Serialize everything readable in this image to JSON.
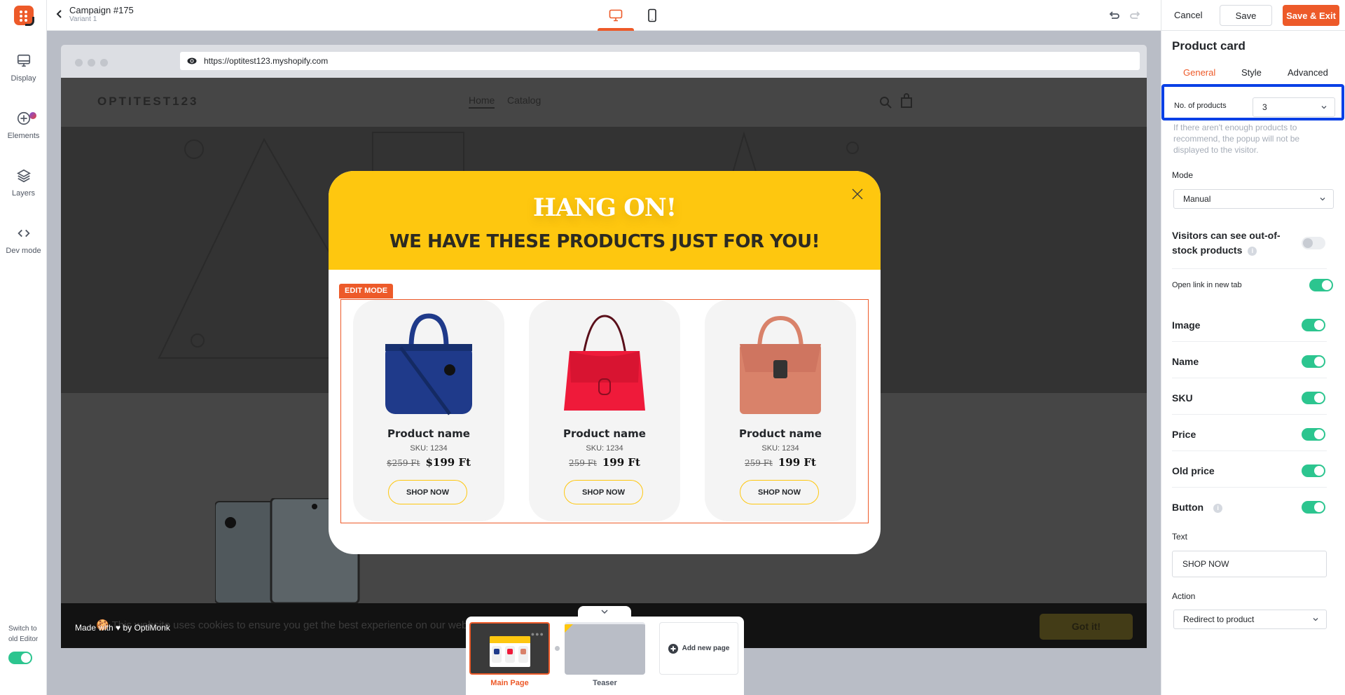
{
  "app": {
    "campaign_title": "Campaign #175",
    "variant": "Variant 1",
    "icons": {
      "logo": "optimonk-logo",
      "back": "chevron-left-icon",
      "desktop": "desktop-icon",
      "mobile": "mobile-icon",
      "undo": "undo-icon",
      "redo": "redo-icon"
    },
    "active_device": "desktop"
  },
  "actions": {
    "cancel": "Cancel",
    "save": "Save",
    "save_exit": "Save & Exit"
  },
  "sidebar": {
    "items": [
      {
        "label": "Display",
        "icon": "monitor-icon"
      },
      {
        "label": "Elements",
        "icon": "plus-circle-icon",
        "has_notification": true
      },
      {
        "label": "Layers",
        "icon": "layers-icon"
      },
      {
        "label": "Dev mode",
        "icon": "code-icon"
      }
    ],
    "switch_old_editor": "Switch to old Editor",
    "switch_old_editor_on": true
  },
  "browser": {
    "url": "https://optitest123.myshopify.com"
  },
  "store": {
    "logo": "OPTITEST123",
    "nav": [
      "Home",
      "Catalog"
    ],
    "cookie_text": "This website uses cookies to ensure you get the best experience on our website",
    "cookie_button": "Got it!",
    "made_with": "Made with ♥ by OptiMonk"
  },
  "popup": {
    "headline": "HANG ON!",
    "subheadline": "WE HAVE THESE PRODUCTS JUST FOR YOU!",
    "edit_badge": "EDIT MODE",
    "products": [
      {
        "name": "Product name",
        "sku": "SKU: 1234",
        "old_price": "$259 Ft",
        "price": "$199 Ft",
        "button": "SHOP NOW",
        "color": "#1f3a8a"
      },
      {
        "name": "Product name",
        "sku": "SKU: 1234",
        "old_price": "259 Ft",
        "price": "199 Ft",
        "button": "SHOP NOW",
        "color": "#ef1a3a"
      },
      {
        "name": "Product name",
        "sku": "SKU: 1234",
        "old_price": "259 Ft",
        "price": "199 Ft",
        "button": "SHOP NOW",
        "color": "#d9826a"
      }
    ]
  },
  "pages": {
    "items": [
      {
        "label": "Main Page",
        "active": true
      },
      {
        "label": "Teaser",
        "active": false
      }
    ],
    "add_label": "Add new page"
  },
  "panel": {
    "title": "Product card",
    "tabs": [
      {
        "label": "General",
        "active": true
      },
      {
        "label": "Style",
        "active": false
      },
      {
        "label": "Advanced",
        "active": false
      }
    ],
    "no_products_label": "No. of products",
    "no_products_value": "3",
    "no_products_help": "If there aren't enough products to recommend, the popup will not be displayed to the visitor.",
    "mode_label": "Mode",
    "mode_value": "Manual",
    "out_of_stock_label": "Visitors can see out-of-stock products",
    "out_of_stock_on": false,
    "open_new_tab_label": "Open link in new tab",
    "open_new_tab_on": true,
    "toggles": [
      {
        "label": "Image",
        "on": true
      },
      {
        "label": "Name",
        "on": true
      },
      {
        "label": "SKU",
        "on": true
      },
      {
        "label": "Price",
        "on": true
      },
      {
        "label": "Old price",
        "on": true
      },
      {
        "label": "Button",
        "on": true,
        "info": true
      }
    ],
    "text_label": "Text",
    "text_value": "SHOP NOW",
    "action_label": "Action",
    "action_value": "Redirect to product"
  }
}
